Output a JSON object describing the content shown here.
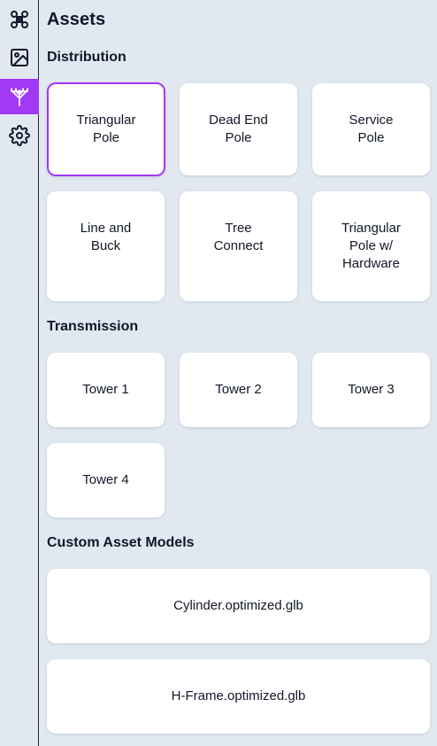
{
  "sidebar": {
    "items": [
      {
        "icon": "drone-icon",
        "label": ""
      },
      {
        "icon": "image-icon",
        "label": ""
      },
      {
        "icon": "antenna-pole-icon",
        "label": "",
        "active": true
      },
      {
        "icon": "gear-icon",
        "label": ""
      }
    ],
    "accent_color": "#a239f5"
  },
  "page": {
    "title": "Assets"
  },
  "sections": {
    "distribution": {
      "title": "Distribution",
      "items": [
        "Triangular\nPole",
        "Dead End\nPole",
        "Service\nPole",
        "Line and\nBuck",
        "Tree\nConnect",
        "Triangular\nPole w/\nHardware"
      ],
      "selected_index": 0
    },
    "transmission": {
      "title": "Transmission",
      "items": [
        "Tower 1",
        "Tower 2",
        "Tower 3",
        "Tower 4"
      ]
    },
    "custom": {
      "title": "Custom Asset Models",
      "items": [
        "Cylinder.optimized.glb",
        "H-Frame.optimized.glb"
      ]
    }
  }
}
